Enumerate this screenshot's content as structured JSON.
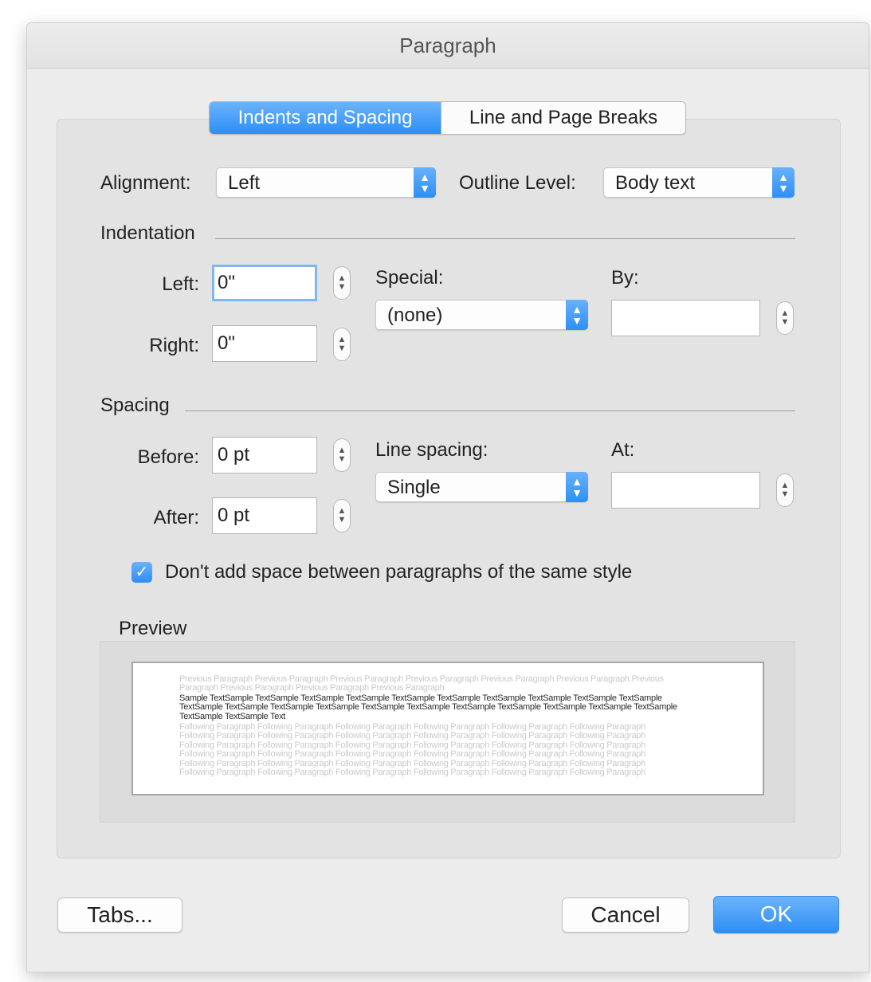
{
  "dialog": {
    "title": "Paragraph"
  },
  "tabs": [
    {
      "label": "Indents and Spacing",
      "active": true
    },
    {
      "label": "Line and Page Breaks",
      "active": false
    }
  ],
  "general": {
    "alignment_label": "Alignment:",
    "alignment_value": "Left",
    "outline_label": "Outline Level:",
    "outline_value": "Body text"
  },
  "indentation": {
    "title": "Indentation",
    "left_label": "Left:",
    "left_value": "0\"",
    "right_label": "Right:",
    "right_value": "0\"",
    "special_label": "Special:",
    "special_value": "(none)",
    "by_label": "By:",
    "by_value": ""
  },
  "spacing": {
    "title": "Spacing",
    "before_label": "Before:",
    "before_value": "0 pt",
    "after_label": "After:",
    "after_value": "0 pt",
    "line_spacing_label": "Line spacing:",
    "line_spacing_value": "Single",
    "at_label": "At:",
    "at_value": ""
  },
  "options": {
    "dont_add_space_label": "Don't add space between paragraphs of the same style",
    "dont_add_space_checked": true
  },
  "preview": {
    "title": "Preview",
    "previous_text": "Previous Paragraph Previous Paragraph Previous Paragraph Previous Paragraph Previous Paragraph Previous Paragraph Previous Paragraph Previous Paragraph Previous Paragraph Previous Paragraph",
    "sample_text": "Sample TextSample TextSample TextSample TextSample TextSample TextSample TextSample TextSample TextSample TextSample TextSample TextSample TextSample TextSample TextSample TextSample TextSample TextSample TextSample TextSample TextSample TextSample TextSample Text",
    "following_text": "Following Paragraph Following Paragraph Following Paragraph Following Paragraph Following Paragraph Following Paragraph Following Paragraph Following Paragraph Following Paragraph Following Paragraph Following Paragraph Following Paragraph Following Paragraph Following Paragraph Following Paragraph Following Paragraph Following Paragraph Following Paragraph Following Paragraph Following Paragraph Following Paragraph Following Paragraph Following Paragraph Following Paragraph Following Paragraph Following Paragraph Following Paragraph Following Paragraph Following Paragraph Following Paragraph Following Paragraph Following Paragraph Following Paragraph Following Paragraph Following Paragraph Following Paragraph"
  },
  "buttons": {
    "tabs": "Tabs...",
    "cancel": "Cancel",
    "ok": "OK"
  },
  "icons": {
    "stepper": "up-down-stepper-icon",
    "select": "chevron-up-down-icon",
    "check": "checkmark-icon"
  },
  "colors": {
    "accent": "#2e8ff5",
    "panel": "#e3e3e3",
    "window": "#ececec"
  }
}
